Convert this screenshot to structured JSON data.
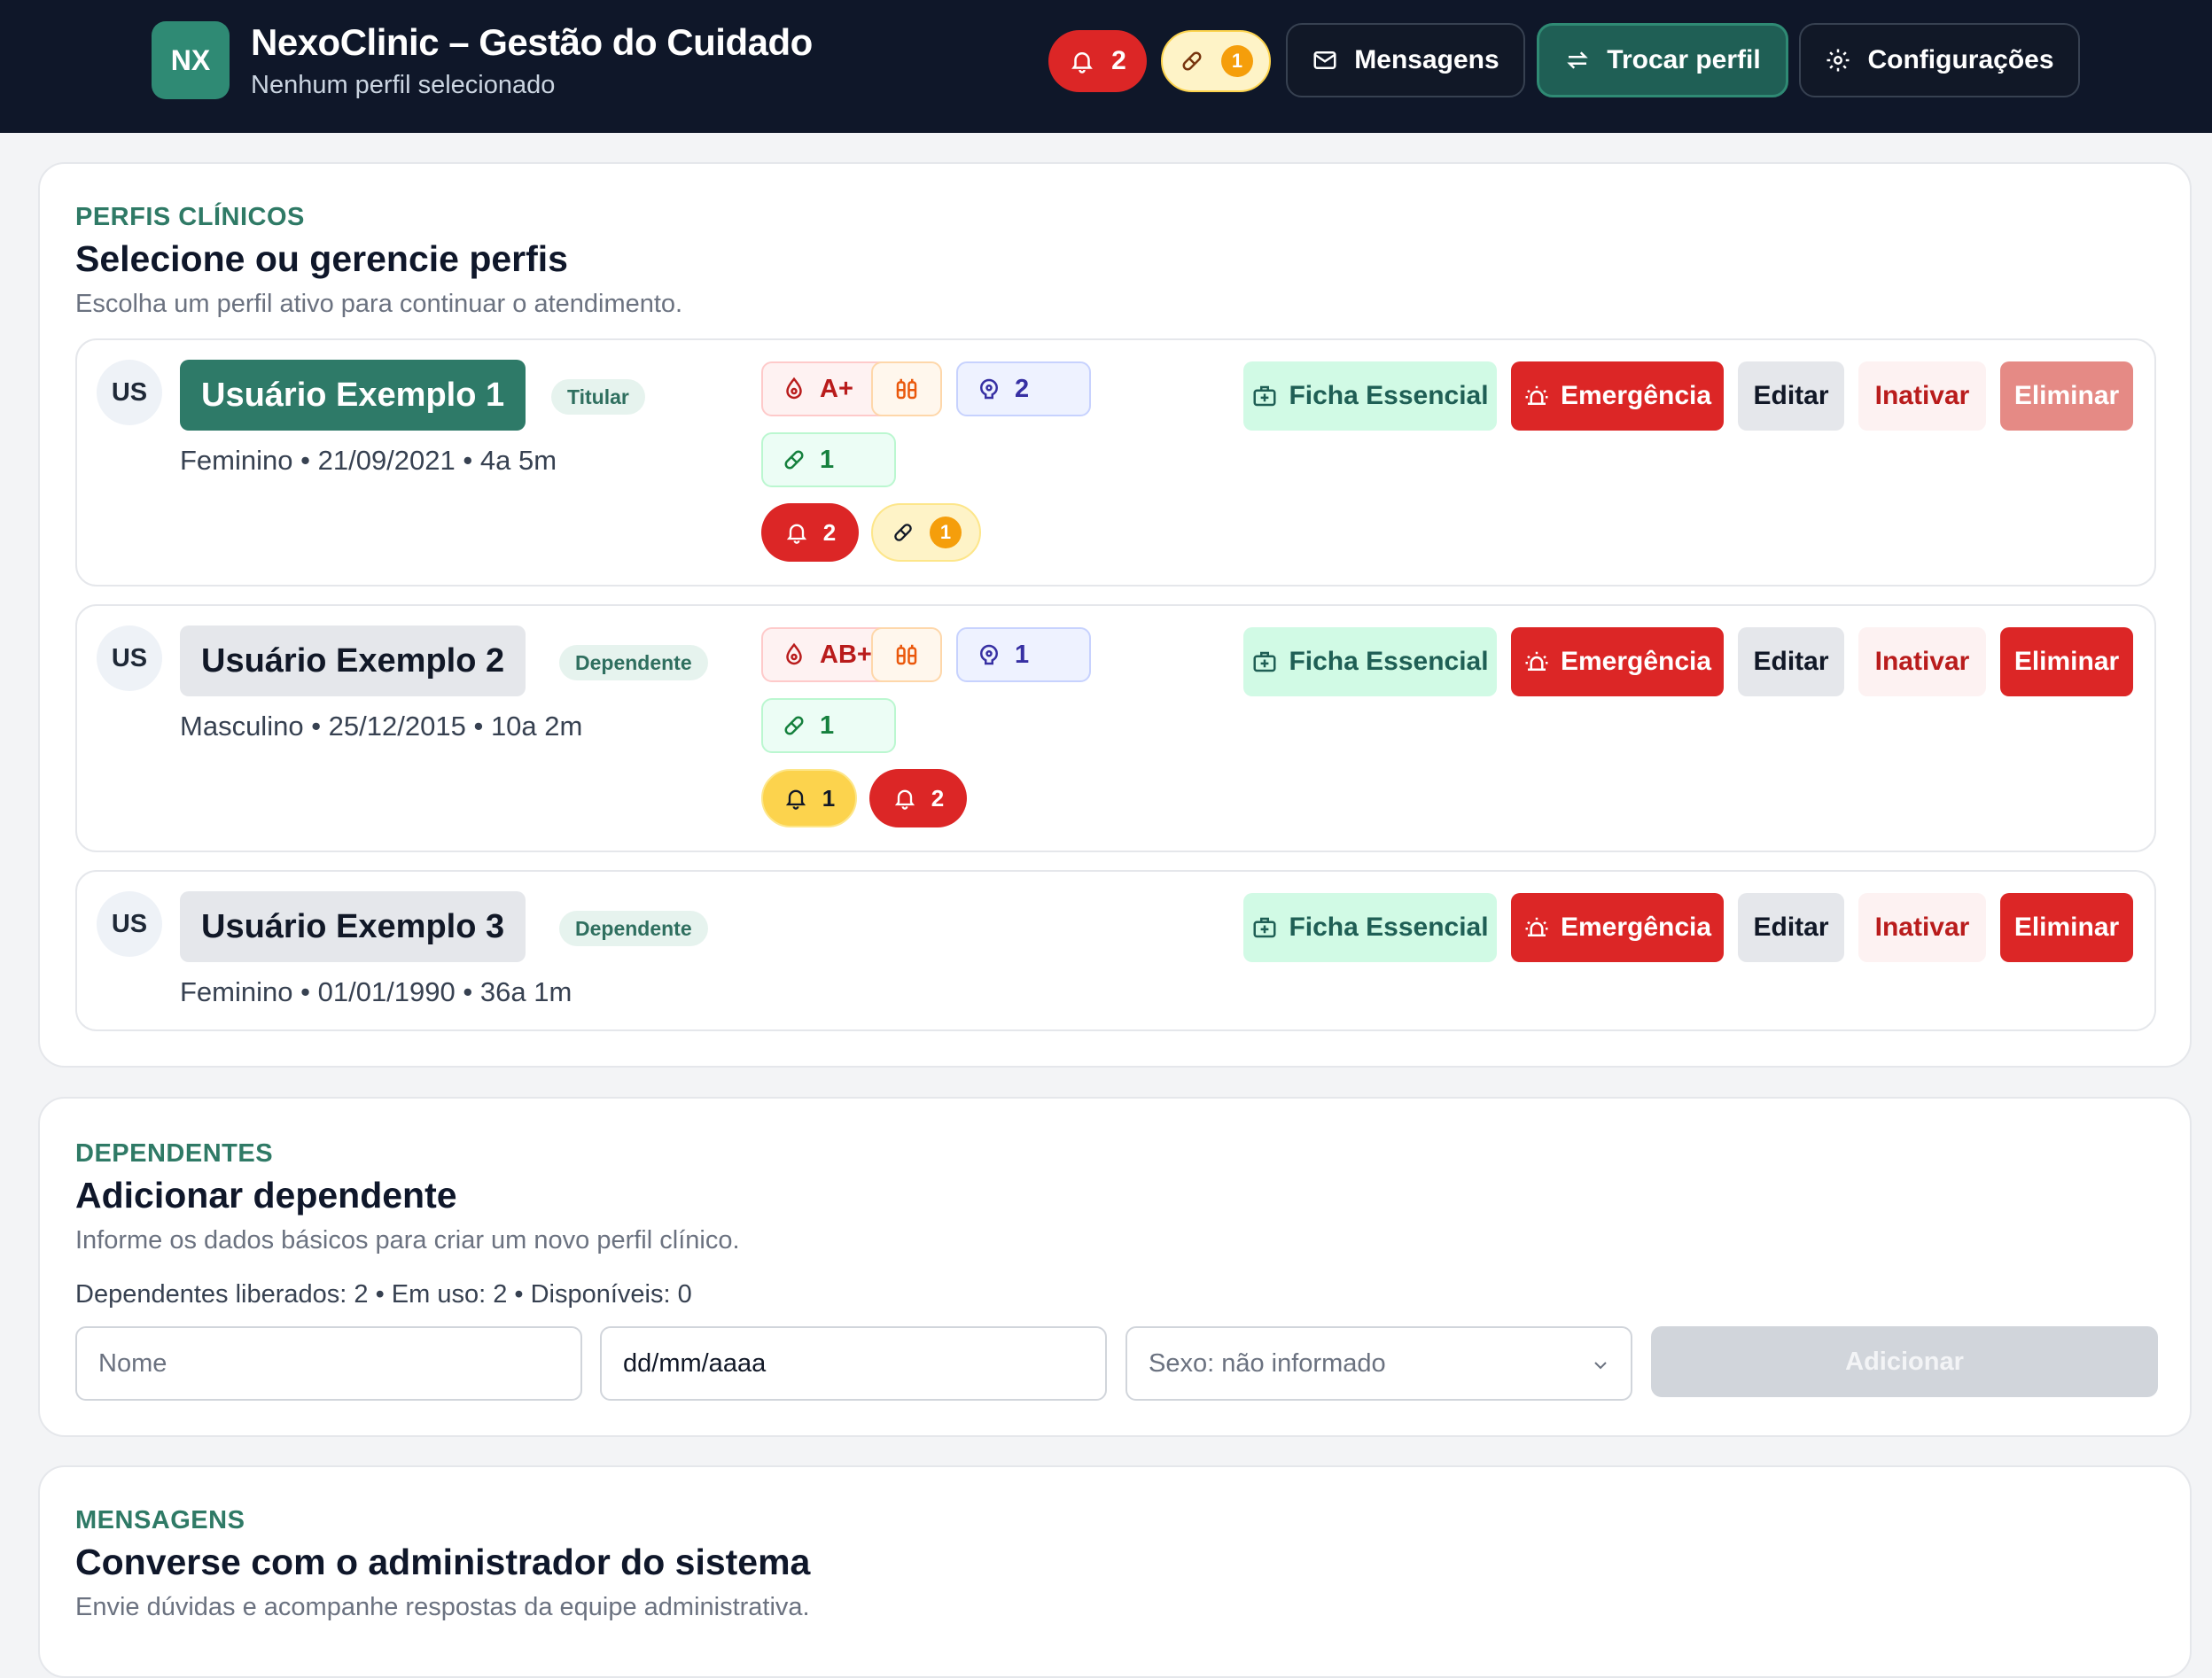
{
  "header": {
    "logo": "NX",
    "title": "NexoClinic – Gestão do Cuidado",
    "subtitle": "Nenhum perfil selecionado",
    "alerts_count": "2",
    "pill_count": "1",
    "messages_label": "Mensagens",
    "switch_label": "Trocar perfil",
    "settings_label": "Configurações"
  },
  "profiles_section": {
    "eyebrow": "PERFIS CLÍNICOS",
    "title": "Selecione ou gerencie perfis",
    "description": "Escolha um perfil ativo para continuar o atendimento.",
    "actions": {
      "ficha": "Ficha Essencial",
      "emergency": "Emergência",
      "edit": "Editar",
      "deactivate": "Inativar",
      "delete": "Eliminar"
    },
    "profiles": [
      {
        "avatar": "US",
        "name": "Usuário Exemplo 1",
        "role": "Titular",
        "sex": "Feminino",
        "birth": "21/09/2021",
        "age": "4a 5m",
        "blood": "A+",
        "brain_count": "2",
        "pill_count": "1",
        "alert_red": "2",
        "alert_pill": "1"
      },
      {
        "avatar": "US",
        "name": "Usuário Exemplo 2",
        "role": "Dependente",
        "sex": "Masculino",
        "birth": "25/12/2015",
        "age": "10a 2m",
        "blood": "AB+",
        "brain_count": "1",
        "pill_count": "1",
        "alert_yellow": "1",
        "alert_red": "2"
      },
      {
        "avatar": "US",
        "name": "Usuário Exemplo 3",
        "role": "Dependente",
        "sex": "Feminino",
        "birth": "01/01/1990",
        "age": "36a 1m"
      }
    ]
  },
  "dependents_section": {
    "eyebrow": "DEPENDENTES",
    "title": "Adicionar dependente",
    "description": "Informe os dados básicos para criar um novo perfil clínico.",
    "stats": "Dependentes liberados: 2 • Em uso: 2 • Disponíveis: 0",
    "name_placeholder": "Nome",
    "date_value": "dd/mm/aaaa",
    "sex_value": "Sexo: não informado",
    "add_label": "Adicionar"
  },
  "messages_section": {
    "eyebrow": "MENSAGENS",
    "title": "Converse com o administrador do sistema",
    "description": "Envie dúvidas e acompanhe respostas da equipe administrativa."
  },
  "separator": "•"
}
